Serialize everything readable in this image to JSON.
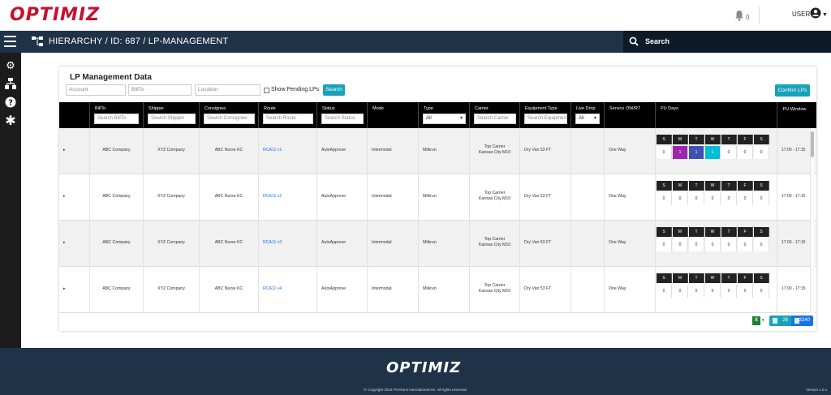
{
  "header": {
    "logo_text": "OPTIMIZ",
    "notifications_count": "0",
    "user_label": "USER"
  },
  "nav": {
    "breadcrumb": "HIERARCHY / ID: 687 / LP-MANAGEMENT",
    "search_placeholder": "Search"
  },
  "card": {
    "title": "LP Management Data",
    "filters": {
      "account_placeholder": "Account",
      "billto_placeholder": "BillTo",
      "location_placeholder": "Location",
      "pending_label": "Show Pending LPs",
      "search_button": "Search"
    },
    "confirm_button": "Confirm LPs"
  },
  "table": {
    "columns": {
      "billto": {
        "label": "BillTo",
        "placeholder": "Search BillTo"
      },
      "shipper": {
        "label": "Shipper",
        "placeholder": "Search Shipper"
      },
      "consignee": {
        "label": "Consignee",
        "placeholder": "Search Consignee"
      },
      "route": {
        "label": "Route",
        "placeholder": "Search Route"
      },
      "status": {
        "label": "Status",
        "placeholder": "Search Status"
      },
      "mode": {
        "label": "Mode"
      },
      "type": {
        "label": "Type",
        "selected": "All"
      },
      "carrier": {
        "label": "Carrier",
        "placeholder": "Search Carrier"
      },
      "equipment": {
        "label": "Equipment Type",
        "placeholder": "Search Equipment"
      },
      "livedrop": {
        "label": "Live Drop",
        "selected": "All"
      },
      "service": {
        "label": "Service OW/RT"
      },
      "pudays": {
        "label": "PU Days"
      },
      "puwindow": {
        "label": "PU Window"
      }
    },
    "day_letters": [
      "S",
      "M",
      "T",
      "W",
      "T",
      "F",
      "S"
    ],
    "rows": [
      {
        "billto": "ABC Company",
        "shipper": "XYZ Company",
        "consignee": "ABC Nurse KC",
        "route": "RCA11 v1",
        "status": "AutoApprove",
        "mode": "Intermodal",
        "type": "Milkrun",
        "carrier_line1": "Top Carrier",
        "carrier_line2": "Kansas City M10",
        "equipment": "Dry Van 53 FT",
        "service": "One Way",
        "days": [
          "0",
          "1",
          "1",
          "1",
          "0",
          "0",
          "0"
        ],
        "window": "17:00 - 17:15"
      },
      {
        "billto": "ABC Company",
        "shipper": "XYZ Company",
        "consignee": "ABC Nurse KC",
        "route": "RCA11 v2",
        "status": "AutoApprove",
        "mode": "Intermodal",
        "type": "Milkrun",
        "carrier_line1": "Top Carrier",
        "carrier_line2": "Kansas City M10",
        "equipment": "Dry Van 53 FT",
        "service": "One Way",
        "days": [
          "0",
          "0",
          "0",
          "0",
          "0",
          "0",
          "0"
        ],
        "window": "17:00 - 17:15"
      },
      {
        "billto": "ABC Company",
        "shipper": "XYZ Company",
        "consignee": "ABC Nurse KC",
        "route": "RCA11 v3",
        "status": "AutoApprove",
        "mode": "Intermodal",
        "type": "Milkrun",
        "carrier_line1": "Top Carrier",
        "carrier_line2": "Kansas City M10",
        "equipment": "Dry Van 53 FT",
        "service": "One Way",
        "days": [
          "0",
          "0",
          "0",
          "0",
          "0",
          "0",
          "0"
        ],
        "window": "17:00 - 17:15"
      },
      {
        "billto": "ABC Company",
        "shipper": "XYZ Company",
        "consignee": "ABC Nurse KC",
        "route": "RCA11 v4",
        "status": "AutoApprove",
        "mode": "Intermodal",
        "type": "Milkrun",
        "carrier_line1": "Top Carrier",
        "carrier_line2": "Kansas City M10",
        "equipment": "Dry Van 53 FT",
        "service": "One Way",
        "days": [
          "0",
          "0",
          "0",
          "0",
          "0",
          "0",
          "0"
        ],
        "window": "17:00 - 17:15"
      }
    ],
    "day_highlight_colors": [
      "",
      "#9b27b0",
      "#3f51b5",
      "#00bcd4",
      "",
      "",
      ""
    ]
  },
  "summary": {
    "count_a": "26",
    "count_b": "3240"
  },
  "footer": {
    "logo_text": "OPTIMIZ",
    "copyright": "© Copyright 2019 ProTrans International Inc. All rights reserved.",
    "version": "Version 1.0.1"
  },
  "colors": {
    "brand_red": "#c8102e",
    "navy": "#1f3348",
    "teal": "#17a2b8",
    "blue": "#1a73e8"
  }
}
